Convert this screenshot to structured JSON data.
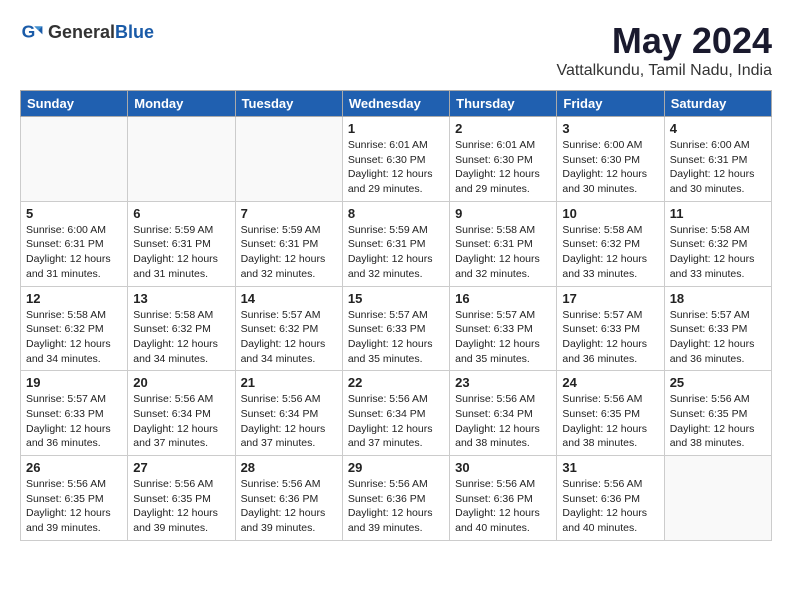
{
  "header": {
    "logo_general": "General",
    "logo_blue": "Blue",
    "month": "May 2024",
    "location": "Vattalkundu, Tamil Nadu, India"
  },
  "days_of_week": [
    "Sunday",
    "Monday",
    "Tuesday",
    "Wednesday",
    "Thursday",
    "Friday",
    "Saturday"
  ],
  "weeks": [
    [
      {
        "day": "",
        "info": ""
      },
      {
        "day": "",
        "info": ""
      },
      {
        "day": "",
        "info": ""
      },
      {
        "day": "1",
        "info": "Sunrise: 6:01 AM\nSunset: 6:30 PM\nDaylight: 12 hours\nand 29 minutes."
      },
      {
        "day": "2",
        "info": "Sunrise: 6:01 AM\nSunset: 6:30 PM\nDaylight: 12 hours\nand 29 minutes."
      },
      {
        "day": "3",
        "info": "Sunrise: 6:00 AM\nSunset: 6:30 PM\nDaylight: 12 hours\nand 30 minutes."
      },
      {
        "day": "4",
        "info": "Sunrise: 6:00 AM\nSunset: 6:31 PM\nDaylight: 12 hours\nand 30 minutes."
      }
    ],
    [
      {
        "day": "5",
        "info": "Sunrise: 6:00 AM\nSunset: 6:31 PM\nDaylight: 12 hours\nand 31 minutes."
      },
      {
        "day": "6",
        "info": "Sunrise: 5:59 AM\nSunset: 6:31 PM\nDaylight: 12 hours\nand 31 minutes."
      },
      {
        "day": "7",
        "info": "Sunrise: 5:59 AM\nSunset: 6:31 PM\nDaylight: 12 hours\nand 32 minutes."
      },
      {
        "day": "8",
        "info": "Sunrise: 5:59 AM\nSunset: 6:31 PM\nDaylight: 12 hours\nand 32 minutes."
      },
      {
        "day": "9",
        "info": "Sunrise: 5:58 AM\nSunset: 6:31 PM\nDaylight: 12 hours\nand 32 minutes."
      },
      {
        "day": "10",
        "info": "Sunrise: 5:58 AM\nSunset: 6:32 PM\nDaylight: 12 hours\nand 33 minutes."
      },
      {
        "day": "11",
        "info": "Sunrise: 5:58 AM\nSunset: 6:32 PM\nDaylight: 12 hours\nand 33 minutes."
      }
    ],
    [
      {
        "day": "12",
        "info": "Sunrise: 5:58 AM\nSunset: 6:32 PM\nDaylight: 12 hours\nand 34 minutes."
      },
      {
        "day": "13",
        "info": "Sunrise: 5:58 AM\nSunset: 6:32 PM\nDaylight: 12 hours\nand 34 minutes."
      },
      {
        "day": "14",
        "info": "Sunrise: 5:57 AM\nSunset: 6:32 PM\nDaylight: 12 hours\nand 34 minutes."
      },
      {
        "day": "15",
        "info": "Sunrise: 5:57 AM\nSunset: 6:33 PM\nDaylight: 12 hours\nand 35 minutes."
      },
      {
        "day": "16",
        "info": "Sunrise: 5:57 AM\nSunset: 6:33 PM\nDaylight: 12 hours\nand 35 minutes."
      },
      {
        "day": "17",
        "info": "Sunrise: 5:57 AM\nSunset: 6:33 PM\nDaylight: 12 hours\nand 36 minutes."
      },
      {
        "day": "18",
        "info": "Sunrise: 5:57 AM\nSunset: 6:33 PM\nDaylight: 12 hours\nand 36 minutes."
      }
    ],
    [
      {
        "day": "19",
        "info": "Sunrise: 5:57 AM\nSunset: 6:33 PM\nDaylight: 12 hours\nand 36 minutes."
      },
      {
        "day": "20",
        "info": "Sunrise: 5:56 AM\nSunset: 6:34 PM\nDaylight: 12 hours\nand 37 minutes."
      },
      {
        "day": "21",
        "info": "Sunrise: 5:56 AM\nSunset: 6:34 PM\nDaylight: 12 hours\nand 37 minutes."
      },
      {
        "day": "22",
        "info": "Sunrise: 5:56 AM\nSunset: 6:34 PM\nDaylight: 12 hours\nand 37 minutes."
      },
      {
        "day": "23",
        "info": "Sunrise: 5:56 AM\nSunset: 6:34 PM\nDaylight: 12 hours\nand 38 minutes."
      },
      {
        "day": "24",
        "info": "Sunrise: 5:56 AM\nSunset: 6:35 PM\nDaylight: 12 hours\nand 38 minutes."
      },
      {
        "day": "25",
        "info": "Sunrise: 5:56 AM\nSunset: 6:35 PM\nDaylight: 12 hours\nand 38 minutes."
      }
    ],
    [
      {
        "day": "26",
        "info": "Sunrise: 5:56 AM\nSunset: 6:35 PM\nDaylight: 12 hours\nand 39 minutes."
      },
      {
        "day": "27",
        "info": "Sunrise: 5:56 AM\nSunset: 6:35 PM\nDaylight: 12 hours\nand 39 minutes."
      },
      {
        "day": "28",
        "info": "Sunrise: 5:56 AM\nSunset: 6:36 PM\nDaylight: 12 hours\nand 39 minutes."
      },
      {
        "day": "29",
        "info": "Sunrise: 5:56 AM\nSunset: 6:36 PM\nDaylight: 12 hours\nand 39 minutes."
      },
      {
        "day": "30",
        "info": "Sunrise: 5:56 AM\nSunset: 6:36 PM\nDaylight: 12 hours\nand 40 minutes."
      },
      {
        "day": "31",
        "info": "Sunrise: 5:56 AM\nSunset: 6:36 PM\nDaylight: 12 hours\nand 40 minutes."
      },
      {
        "day": "",
        "info": ""
      }
    ]
  ]
}
